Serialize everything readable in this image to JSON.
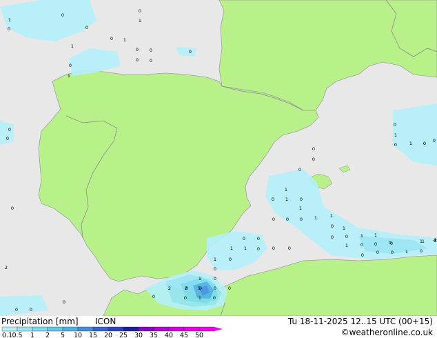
{
  "footer": {
    "title": "Precipitation [mm]",
    "model": "ICON",
    "valid_time": "Tu 18-11-2025 12..15 UTC (00+15)",
    "credit": "©weatheronline.co.uk"
  },
  "colorbar": {
    "ticks": [
      "0.1",
      "0.5",
      "1",
      "2",
      "5",
      "10",
      "15",
      "20",
      "25",
      "30",
      "35",
      "40",
      "45",
      "50"
    ],
    "colors": [
      "#b4f0fa",
      "#96e6f5",
      "#78dcf0",
      "#5fc8ec",
      "#4ab0e6",
      "#3f8ee0",
      "#3564d0",
      "#2a42bc",
      "#1e1e9a",
      "#8a00c8",
      "#b000d8",
      "#cc00e0",
      "#e400e8",
      "#f000f0"
    ]
  },
  "map_colors": {
    "land": "#b8f08a",
    "sea": "#e8e8e8",
    "border": "#8c8c8c",
    "coast": "#a0a0a0"
  },
  "value_labels": [
    "0",
    "1",
    "0",
    "0",
    "1",
    "0",
    "0",
    "1",
    "1",
    "0",
    "0",
    "0",
    "0",
    "0",
    "0",
    "1",
    "0",
    "0",
    "0",
    "0",
    "0",
    "1",
    "0",
    "1",
    "0",
    "0",
    "0",
    "1",
    "0",
    "1",
    "0",
    "1",
    "0",
    "0",
    "0",
    "1",
    "1",
    "0",
    "1",
    "0",
    "0",
    "1",
    "1",
    "1",
    "0",
    "0",
    "0",
    "1",
    "0",
    "0",
    "0",
    "1",
    "1",
    "0",
    "0",
    "0",
    "0",
    "1",
    "4",
    "0",
    "0",
    "1",
    "0",
    "0",
    "2",
    "1",
    "0",
    "0",
    "0",
    "1",
    "0",
    "0",
    "0",
    "0",
    "0",
    "2",
    "2",
    "5",
    "1",
    "0",
    "0",
    "0",
    "2",
    "0",
    "0",
    "0",
    "0"
  ]
}
